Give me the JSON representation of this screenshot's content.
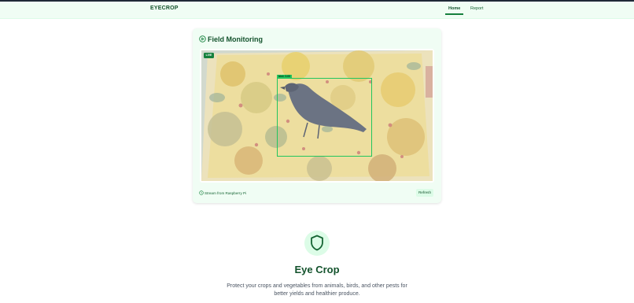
{
  "brand": {
    "name": "EYECROP"
  },
  "nav": {
    "home_label": "Home",
    "report_label": "Report",
    "active": "Home"
  },
  "monitor": {
    "title": "Field Monitoring",
    "live_label": "LIVE",
    "detection_label": "bird: 0.00",
    "stream_text": "Stream from Raspberry Pi",
    "refresh_label": "Refresh"
  },
  "hero": {
    "title": "Eye Crop",
    "description": "Protect your crops and vegetables from animals, birds, and other pests for better yields and healthier produce."
  },
  "colors": {
    "accent": "#15803d",
    "heading": "#14532d",
    "card_bg": "#f0fdf4",
    "detection": "#22c55e"
  },
  "icons": {
    "title": "circle-play-icon",
    "stream": "clock-icon",
    "hero": "shield-icon"
  }
}
